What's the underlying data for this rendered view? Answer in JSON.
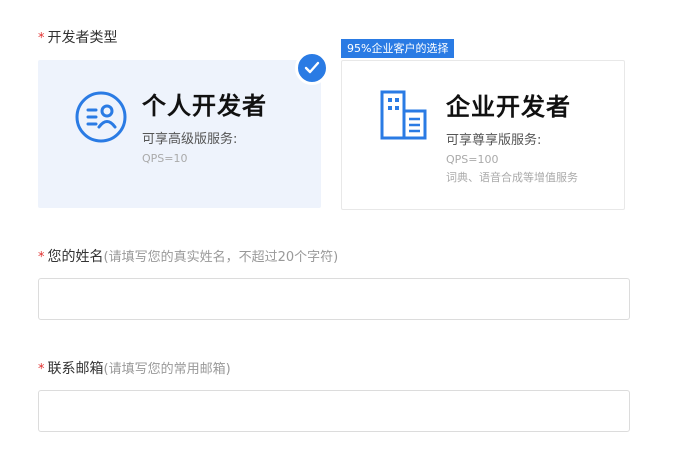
{
  "developer_type": {
    "required_mark": "*",
    "label": "开发者类型"
  },
  "cards": {
    "personal": {
      "title": "个人开发者",
      "subtitle": "可享高级版服务:",
      "note": "QPS=10",
      "selected": true
    },
    "enterprise": {
      "badge": "95%企业客户的选择",
      "title": "企业开发者",
      "subtitle": "可享尊享版服务:",
      "note_line1": "QPS=100",
      "note_line2": "词典、语音合成等增值服务"
    }
  },
  "name_field": {
    "required_mark": "*",
    "label": "您的姓名",
    "hint": "(请填写您的真实姓名，不超过20个字符)",
    "value": ""
  },
  "email_field": {
    "required_mark": "*",
    "label": "联系邮箱",
    "hint": "(请填写您的常用邮箱)",
    "value": ""
  },
  "colors": {
    "accent": "#2a7be4",
    "selected_bg": "#eef3fc",
    "required": "#e0302f"
  }
}
